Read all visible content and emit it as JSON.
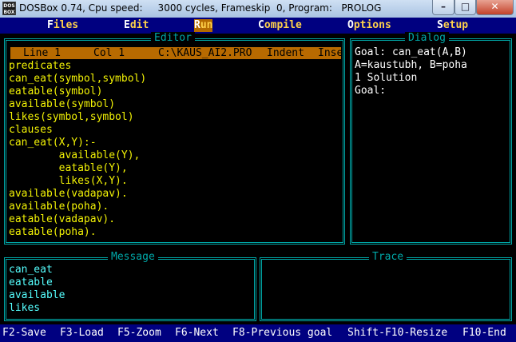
{
  "window": {
    "app_icon_text": "DOS BOX",
    "title": "DOSBox 0.74, Cpu speed:     3000 cycles, Frameskip  0, Program:   PROLOG",
    "minimize": "–",
    "maximize": "□",
    "close": "✕"
  },
  "menu": {
    "files": {
      "hot": "F",
      "rest": "iles"
    },
    "edit": {
      "hot": "E",
      "rest": "dit"
    },
    "run": {
      "hot": "R",
      "rest": "un"
    },
    "compile": {
      "hot": "C",
      "rest": "ompile"
    },
    "options": {
      "hot": "O",
      "rest": "ptions"
    },
    "setup": {
      "hot": "S",
      "rest": "etup"
    }
  },
  "editor": {
    "title": "Editor",
    "status": {
      "line": "Line 1",
      "col": "Col 1",
      "file": "C:\\KAUS_AI2.PRO",
      "mode": "Indent",
      "insert": "Inse"
    },
    "lines": [
      "predicates",
      "can_eat(symbol,symbol)",
      "eatable(symbol)",
      "available(symbol)",
      "likes(symbol,symbol)",
      "clauses",
      "can_eat(X,Y):-",
      "        available(Y),",
      "        eatable(Y),",
      "        likes(X,Y).",
      "available(vadapav).",
      "available(poha).",
      "eatable(vadapav).",
      "eatable(poha)."
    ]
  },
  "dialog": {
    "title": "Dialog",
    "lines": [
      "Goal: can_eat(A,B)",
      "A=kaustubh, B=poha",
      "1 Solution",
      "Goal:"
    ]
  },
  "message": {
    "title": "Message",
    "lines": [
      "can_eat",
      "eatable",
      "available",
      "likes"
    ]
  },
  "trace": {
    "title": "Trace"
  },
  "fkeys": {
    "f2": "F2-Save",
    "f3": "F3-Load",
    "f5": "F5-Zoom",
    "f6": "F6-Next",
    "f8": "F8-Previous goal",
    "sf10": "Shift-F10-Resize",
    "f10": "F10-End"
  },
  "colors": {
    "background": "#000000",
    "menu_bar": "#000080",
    "menu_text": "#ffd24a",
    "frame": "#00a8a8",
    "status_bar": "#b86a00",
    "code_text": "#f2f205",
    "message_text": "#55ffff"
  }
}
